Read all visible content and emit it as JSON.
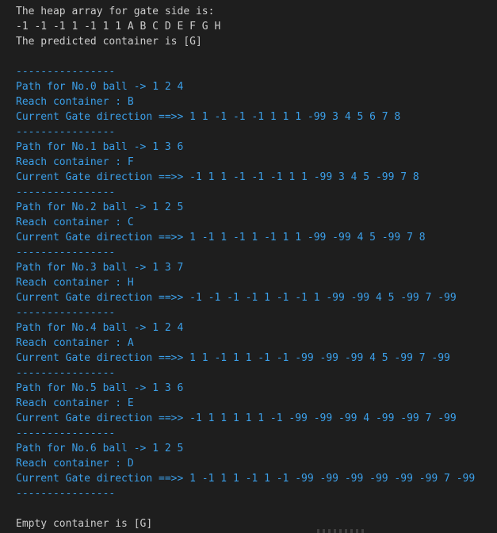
{
  "header": {
    "heap_label": "The heap array for gate side is:",
    "heap_array": "-1 -1 -1 1 -1 1 1 A B C D E F G H",
    "predicted": "The predicted container is [G]"
  },
  "divider": "----------------",
  "balls": [
    {
      "path_label": "Path for No.0 ball -> ",
      "path": "1 2 4",
      "reach_label": "Reach container : ",
      "reach": "B",
      "gate_label": "Current Gate direction ==>> ",
      "gate": "1 1 -1 -1 -1 1 1 1 -99 3 4 5 6 7 8"
    },
    {
      "path_label": "Path for No.1 ball -> ",
      "path": "1 3 6",
      "reach_label": "Reach container : ",
      "reach": "F",
      "gate_label": "Current Gate direction ==>> ",
      "gate": "-1 1 1 -1 -1 -1 1 1 -99 3 4 5 -99 7 8"
    },
    {
      "path_label": "Path for No.2 ball -> ",
      "path": "1 2 5",
      "reach_label": "Reach container : ",
      "reach": "C",
      "gate_label": "Current Gate direction ==>> ",
      "gate": "1 -1 1 -1 1 -1 1 1 -99 -99 4 5 -99 7 8"
    },
    {
      "path_label": "Path for No.3 ball -> ",
      "path": "1 3 7",
      "reach_label": "Reach container : ",
      "reach": "H",
      "gate_label": "Current Gate direction ==>> ",
      "gate": "-1 -1 -1 -1 1 -1 -1 1 -99 -99 4 5 -99 7 -99"
    },
    {
      "path_label": "Path for No.4 ball -> ",
      "path": "1 2 4",
      "reach_label": "Reach container : ",
      "reach": "A",
      "gate_label": "Current Gate direction ==>> ",
      "gate": "1 1 -1 1 1 -1 -1 -99 -99 -99 4 5 -99 7 -99"
    },
    {
      "path_label": "Path for No.5 ball -> ",
      "path": "1 3 6",
      "reach_label": "Reach container : ",
      "reach": "E",
      "gate_label": "Current Gate direction ==>> ",
      "gate": "-1 1 1 1 1 1 -1 -99 -99 -99 4 -99 -99 7 -99"
    },
    {
      "path_label": "Path for No.6 ball -> ",
      "path": "1 2 5",
      "reach_label": "Reach container : ",
      "reach": "D",
      "gate_label": "Current Gate direction ==>> ",
      "gate": "1 -1 1 1 -1 1 -1 -99 -99 -99 -99 -99 -99 7 -99"
    }
  ],
  "footer": {
    "empty": "Empty container is [G]"
  },
  "colors": {
    "background": "#1e1e1e",
    "text": "#cccccc",
    "accent": "#3b9fe8"
  }
}
